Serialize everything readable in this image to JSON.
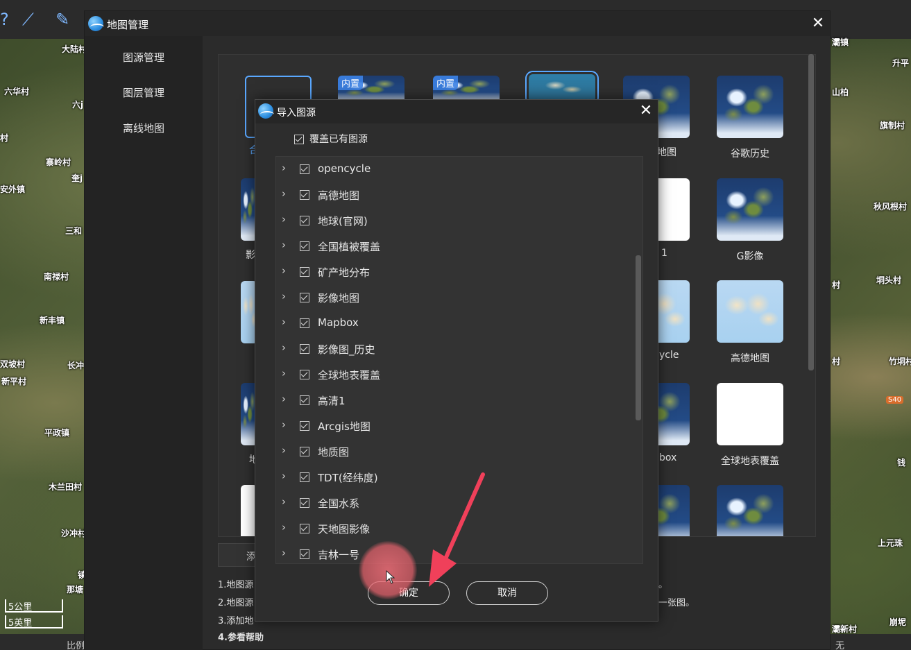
{
  "app": {
    "tools": [
      "?",
      "⟋",
      "✎"
    ]
  },
  "map": {
    "places_left": [
      "大陆村",
      "六华村",
      "六j",
      "村",
      "寨岭村",
      "奎j",
      "安外镇",
      "三和",
      "南禄村",
      "新丰镇",
      "双坡村",
      "长冲",
      "新平村",
      "平政镇",
      "木兰田村",
      "沙冲村",
      "镇",
      "那塘"
    ],
    "places_right": [
      "灞镇",
      "升平",
      "山柏",
      "旗制村",
      "秋风根村",
      "村",
      "垌头村",
      "村",
      "竹垌村",
      "钱",
      "上元珠",
      "灞新村",
      "崩坭"
    ],
    "road_sign": "S40",
    "scale_km": "5公里",
    "scale_mi": "5英里",
    "status_left": "比例",
    "status_right": "无"
  },
  "main_dialog": {
    "title": "地图管理",
    "nav": [
      "图源管理",
      "图层管理",
      "离线地图"
    ],
    "cards": [
      {
        "label": "谷歌历史"
      },
      {
        "label": "地图"
      },
      {
        "label": "G影像"
      },
      {
        "label": "1"
      },
      {
        "label": "高德地图"
      },
      {
        "label": "ycle"
      },
      {
        "label": "全球地表覆盖"
      },
      {
        "label": "box"
      }
    ],
    "left_clipped": [
      "合",
      "影",
      "地"
    ],
    "badges": [
      "内置",
      "内置"
    ],
    "add_button": "添",
    "help": [
      "1.地图源",
      "2.地图源",
      "3.添加地",
      "4.参看帮助"
    ],
    "help_right": [
      "。",
      "一张图。"
    ]
  },
  "import_dialog": {
    "title": "导入图源",
    "override_label": "覆盖已有图源",
    "items": [
      "opencycle",
      "高德地图",
      "地球(官网)",
      "全国植被覆盖",
      "矿产地分布",
      "影像地图",
      "Mapbox",
      "影像图_历史",
      "全球地表覆盖",
      "高清1",
      "Arcgis地图",
      "地质图",
      "TDT(经纬度)",
      "全国水系",
      "天地图影像",
      "吉林一号"
    ],
    "confirm": "确定",
    "cancel": "取消"
  },
  "colors": {
    "accent": "#5aa8ff",
    "arrow": "#f0405a",
    "dialog_bg": "#2d2d2d"
  }
}
